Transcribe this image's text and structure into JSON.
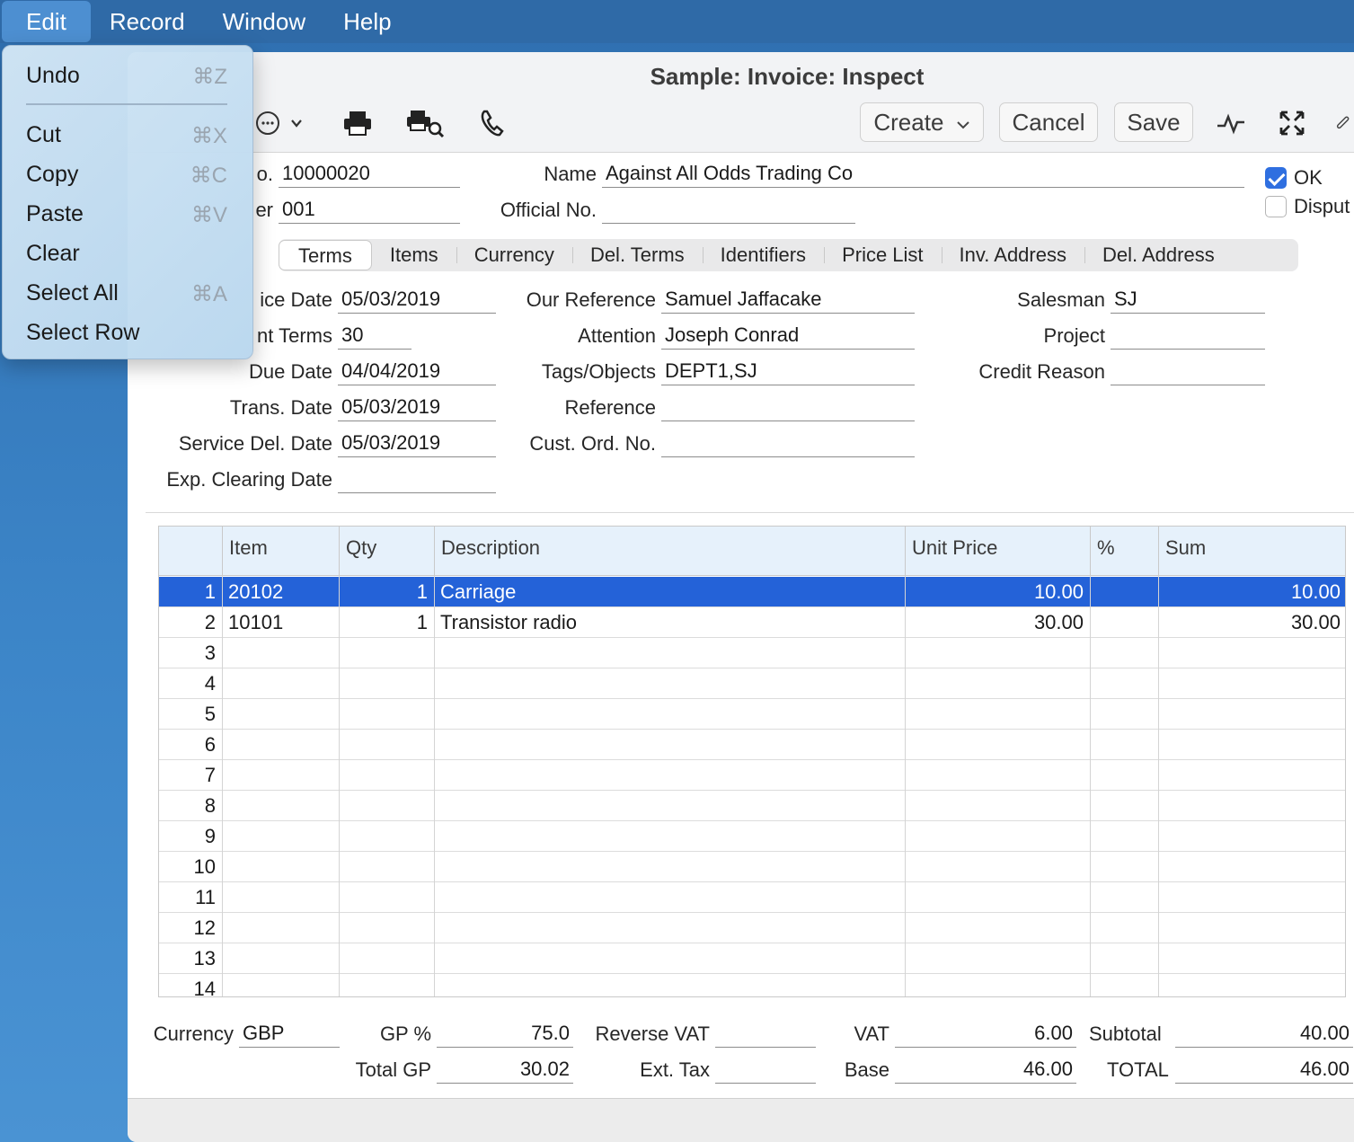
{
  "menubar": {
    "items": [
      "Edit",
      "Record",
      "Window",
      "Help"
    ]
  },
  "edit_menu": {
    "items": [
      {
        "label": "Undo",
        "shortcut": "⌘Z"
      },
      {
        "label": "Cut",
        "shortcut": "⌘X"
      },
      {
        "label": "Copy",
        "shortcut": "⌘C"
      },
      {
        "label": "Paste",
        "shortcut": "⌘V"
      },
      {
        "label": "Clear",
        "shortcut": ""
      },
      {
        "label": "Select All",
        "shortcut": "⌘A"
      },
      {
        "label": "Select Row",
        "shortcut": ""
      }
    ]
  },
  "window": {
    "title": "Sample: Invoice: Inspect"
  },
  "toolbar": {
    "create_label": "Create",
    "cancel_label": "Cancel",
    "save_label": "Save"
  },
  "header": {
    "no_label": "o.",
    "no_value": "10000020",
    "customer_label": "er",
    "customer_value": "001",
    "name_label": "Name",
    "name_value": "Against All Odds Trading Co",
    "official_label": "Official No.",
    "official_value": "",
    "ok_label": "OK",
    "ok_checked": true,
    "disputed_label": "Disput",
    "disputed_checked": false
  },
  "tabs": [
    "Terms",
    "Items",
    "Currency",
    "Del. Terms",
    "Identifiers",
    "Price List",
    "Inv. Address",
    "Del. Address"
  ],
  "terms": {
    "invoice_date_label": "ice Date",
    "invoice_date": "05/03/2019",
    "payment_terms_label": "nt Terms",
    "payment_terms": "30",
    "due_date_label": "Due Date",
    "due_date": "04/04/2019",
    "trans_date_label": "Trans. Date",
    "trans_date": "05/03/2019",
    "service_del_label": "Service Del. Date",
    "service_del": "05/03/2019",
    "exp_clearing_label": "Exp. Clearing Date",
    "exp_clearing": "",
    "our_ref_label": "Our Reference",
    "our_ref": "Samuel Jaffacake",
    "attention_label": "Attention",
    "attention": "Joseph Conrad",
    "tags_label": "Tags/Objects",
    "tags": "DEPT1,SJ",
    "reference_label": "Reference",
    "reference": "",
    "cust_ord_label": "Cust. Ord. No.",
    "cust_ord": "",
    "salesman_label": "Salesman",
    "salesman": "SJ",
    "project_label": "Project",
    "project": "",
    "credit_reason_label": "Credit Reason",
    "credit_reason": ""
  },
  "grid": {
    "columns": [
      "",
      "Item",
      "Qty",
      "Description",
      "Unit Price",
      "%",
      "Sum"
    ],
    "rows": [
      {
        "n": "1",
        "item": "20102",
        "qty": "1",
        "desc": "Carriage",
        "price": "10.00",
        "pct": "",
        "sum": "10.00"
      },
      {
        "n": "2",
        "item": "10101",
        "qty": "1",
        "desc": "Transistor radio",
        "price": "30.00",
        "pct": "",
        "sum": "30.00"
      },
      {
        "n": "3",
        "item": "",
        "qty": "",
        "desc": "",
        "price": "",
        "pct": "",
        "sum": ""
      },
      {
        "n": "4",
        "item": "",
        "qty": "",
        "desc": "",
        "price": "",
        "pct": "",
        "sum": ""
      },
      {
        "n": "5",
        "item": "",
        "qty": "",
        "desc": "",
        "price": "",
        "pct": "",
        "sum": ""
      },
      {
        "n": "6",
        "item": "",
        "qty": "",
        "desc": "",
        "price": "",
        "pct": "",
        "sum": ""
      },
      {
        "n": "7",
        "item": "",
        "qty": "",
        "desc": "",
        "price": "",
        "pct": "",
        "sum": ""
      },
      {
        "n": "8",
        "item": "",
        "qty": "",
        "desc": "",
        "price": "",
        "pct": "",
        "sum": ""
      },
      {
        "n": "9",
        "item": "",
        "qty": "",
        "desc": "",
        "price": "",
        "pct": "",
        "sum": ""
      },
      {
        "n": "10",
        "item": "",
        "qty": "",
        "desc": "",
        "price": "",
        "pct": "",
        "sum": ""
      },
      {
        "n": "11",
        "item": "",
        "qty": "",
        "desc": "",
        "price": "",
        "pct": "",
        "sum": ""
      },
      {
        "n": "12",
        "item": "",
        "qty": "",
        "desc": "",
        "price": "",
        "pct": "",
        "sum": ""
      },
      {
        "n": "13",
        "item": "",
        "qty": "",
        "desc": "",
        "price": "",
        "pct": "",
        "sum": ""
      },
      {
        "n": "14",
        "item": "",
        "qty": "",
        "desc": "",
        "price": "",
        "pct": "",
        "sum": ""
      }
    ]
  },
  "footer": {
    "currency_label": "Currency",
    "currency": "GBP",
    "gp_pct_label": "GP %",
    "gp_pct": "75.0",
    "total_gp_label": "Total GP",
    "total_gp": "30.02",
    "reverse_vat_label": "Reverse VAT",
    "reverse_vat": "",
    "ext_tax_label": "Ext. Tax",
    "ext_tax": "",
    "vat_label": "VAT",
    "vat": "6.00",
    "base_label": "Base",
    "base": "46.00",
    "subtotal_label": "Subtotal",
    "subtotal": "40.00",
    "total_label": "TOTAL",
    "total": "46.00"
  },
  "colors": {
    "accent": "#2462d8",
    "menubar": "#2f6aa7",
    "header_row": "#e6f1fb"
  }
}
